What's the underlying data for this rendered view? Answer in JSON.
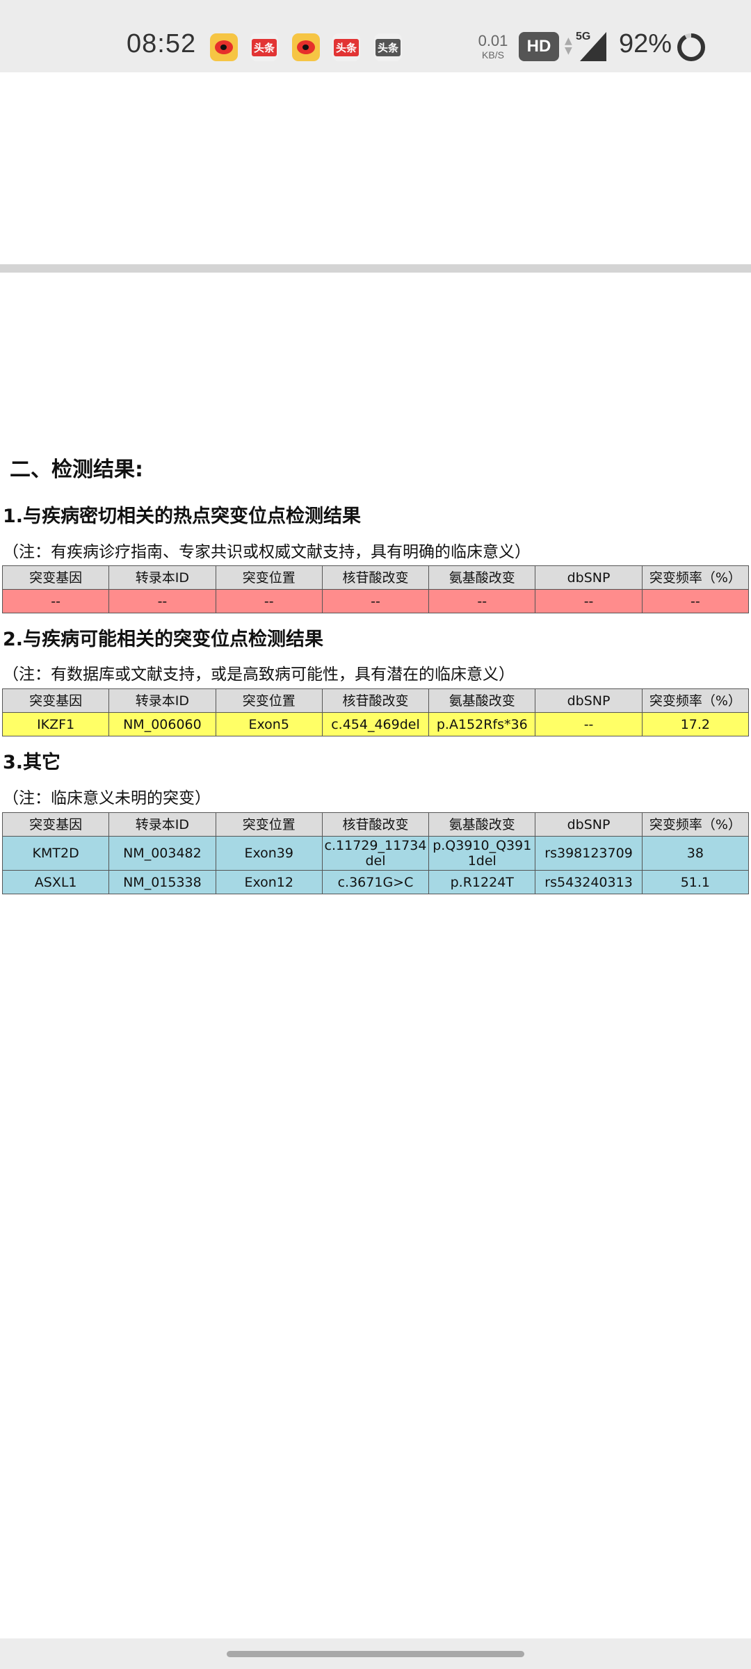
{
  "status_bar": {
    "time": "08:52",
    "app_icons": [
      "weibo",
      "toutiao",
      "weibo",
      "toutiao",
      "toutiao"
    ],
    "toutiao_label": "头条",
    "net_speed_value": "0.01",
    "net_speed_unit": "KB/S",
    "hd_label": "HD",
    "network_label": "5G",
    "battery_text": "92%",
    "battery_level": 0.92
  },
  "report": {
    "main_heading": "二、检测结果:",
    "columns": [
      "突变基因",
      "转录本ID",
      "突变位置",
      "核苷酸改变",
      "氨基酸改变",
      "dbSNP",
      "突变频率（%）"
    ],
    "sections": [
      {
        "title": "1.与疾病密切相关的热点突变位点检测结果",
        "note": "（注：有疾病诊疗指南、专家共识或权威文献支持，具有明确的临床意义）",
        "row_color": "#ff8c8c",
        "rows": [
          [
            "--",
            "--",
            "--",
            "--",
            "--",
            "--",
            "--"
          ]
        ]
      },
      {
        "title": "2.与疾病可能相关的突变位点检测结果",
        "note": "（注：有数据库或文献支持，或是高致病可能性，具有潜在的临床意义）",
        "row_color": "#ffff66",
        "rows": [
          [
            "IKZF1",
            "NM_006060",
            "Exon5",
            "c.454_469del",
            "p.A152Rfs*36",
            "--",
            "17.2"
          ]
        ]
      },
      {
        "title": "3.其它",
        "note": "（注：临床意义未明的突变）",
        "row_color": "#a6d8e4",
        "rows": [
          [
            "KMT2D",
            "NM_003482",
            "Exon39",
            "c.11729_11734del",
            "p.Q3910_Q3911del",
            "rs398123709",
            "38"
          ],
          [
            "ASXL1",
            "NM_015338",
            "Exon12",
            "c.3671G>C",
            "p.R1224T",
            "rs543240313",
            "51.1"
          ]
        ]
      }
    ]
  }
}
